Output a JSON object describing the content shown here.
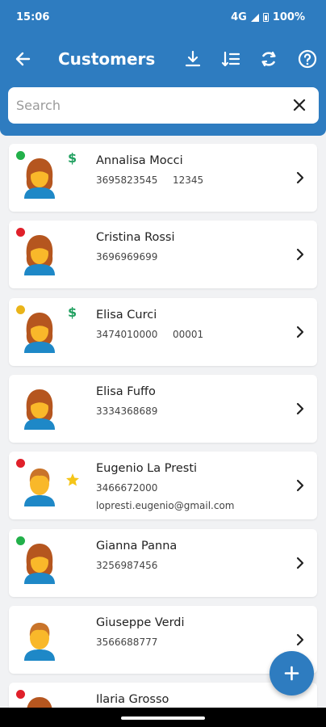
{
  "status_bar": {
    "time": "15:06",
    "network": "4G",
    "battery": "100%"
  },
  "toolbar": {
    "title": "Customers",
    "icons": [
      "arrow-back-icon",
      "download-icon",
      "sort-icon",
      "sync-icon",
      "help-icon"
    ]
  },
  "search": {
    "placeholder": "Search",
    "value": ""
  },
  "colors": {
    "primary": "#2e7cc0",
    "status_green": "#22b04a",
    "status_red": "#e0202a",
    "status_yellow": "#eab419",
    "dollar": "#20a060",
    "star": "#f5c518"
  },
  "customers": [
    {
      "name": "Annalisa Mocci",
      "phone": "3695823545",
      "code": "12345",
      "email": "",
      "status": "green",
      "dollar": true,
      "star": false,
      "gender": "female"
    },
    {
      "name": "Cristina Rossi",
      "phone": "3696969699",
      "code": "",
      "email": "",
      "status": "red",
      "dollar": false,
      "star": false,
      "gender": "female"
    },
    {
      "name": "Elisa Curci",
      "phone": "3474010000",
      "code": "00001",
      "email": "",
      "status": "yellow",
      "dollar": true,
      "star": false,
      "gender": "female"
    },
    {
      "name": "Elisa Fuffo",
      "phone": "3334368689",
      "code": "",
      "email": "",
      "status": "",
      "dollar": false,
      "star": false,
      "gender": "female"
    },
    {
      "name": "Eugenio La Presti",
      "phone": "3466672000",
      "code": "",
      "email": "lopresti.eugenio@gmail.com",
      "status": "red",
      "dollar": false,
      "star": true,
      "gender": "male"
    },
    {
      "name": "Gianna Panna",
      "phone": "3256987456",
      "code": "",
      "email": "",
      "status": "green",
      "dollar": false,
      "star": false,
      "gender": "female"
    },
    {
      "name": "Giuseppe Verdi",
      "phone": "3566688777",
      "code": "",
      "email": "",
      "status": "",
      "dollar": false,
      "star": false,
      "gender": "male"
    },
    {
      "name": "Ilaria Grosso",
      "phone": "",
      "code": "",
      "email": "",
      "status": "red",
      "dollar": false,
      "star": false,
      "gender": "female"
    }
  ],
  "fab": {
    "icon": "plus-icon"
  }
}
